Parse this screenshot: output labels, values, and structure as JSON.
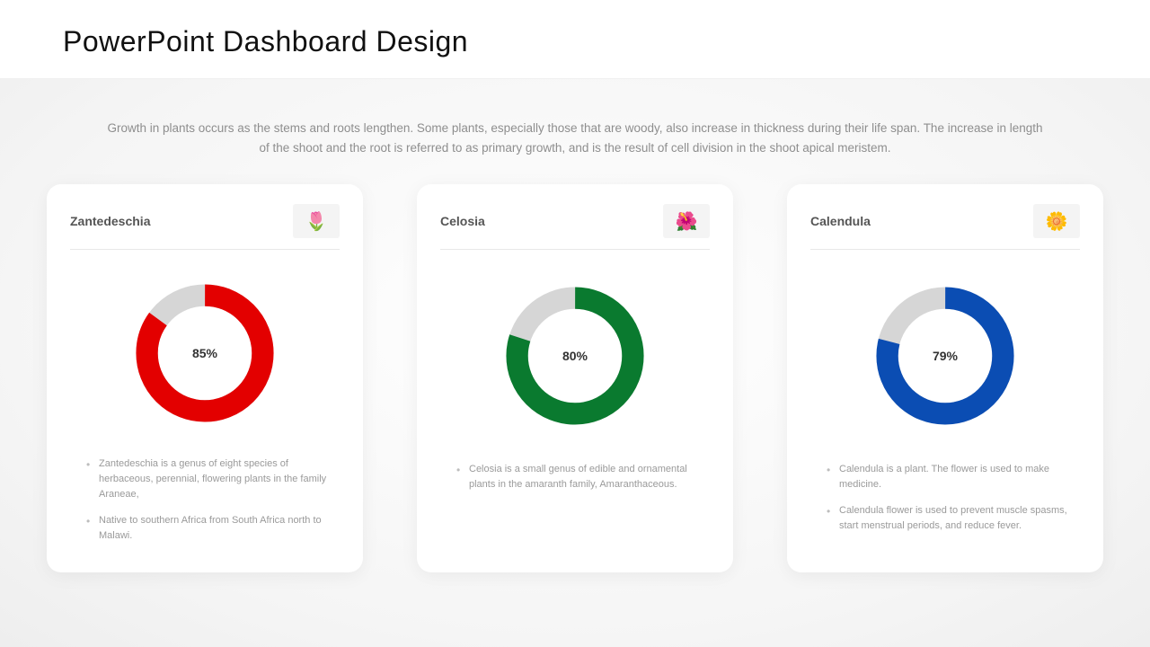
{
  "title": "PowerPoint Dashboard Design",
  "intro": "Growth in plants occurs as the stems and roots lengthen. Some plants, especially those that are woody, also increase in thickness during their life span. The increase in length of the shoot and the root is referred to as primary growth, and is the result of cell division in the shoot apical meristem.",
  "cards": [
    {
      "title": "Zantedeschia",
      "icon": "🌷",
      "percent": 85,
      "percent_label": "85%",
      "color": "#e30000",
      "bg_color": "#d6d6d6",
      "bullets": [
        "Zantedeschia is a genus of eight species of herbaceous, perennial, flowering plants in the family Araneae,",
        "Native to southern Africa from South Africa north to Malawi."
      ]
    },
    {
      "title": "Celosia",
      "icon": "🌺",
      "percent": 80,
      "percent_label": "80%",
      "color": "#0a7a2f",
      "bg_color": "#d6d6d6",
      "bullets": [
        "Celosia is a small genus of edible and ornamental plants in the amaranth family, Amaranthaceous."
      ]
    },
    {
      "title": "Calendula",
      "icon": "🌼",
      "percent": 79,
      "percent_label": "79%",
      "color": "#0b4db3",
      "bg_color": "#d6d6d6",
      "bullets": [
        "Calendula is a plant. The flower is used to make medicine.",
        "Calendula flower is used to prevent muscle spasms, start menstrual periods, and reduce fever."
      ]
    }
  ],
  "chart_data": [
    {
      "type": "pie",
      "title": "Zantedeschia",
      "categories": [
        "value",
        "remaining"
      ],
      "values": [
        85,
        15
      ],
      "colors": [
        "#e30000",
        "#d6d6d6"
      ]
    },
    {
      "type": "pie",
      "title": "Celosia",
      "categories": [
        "value",
        "remaining"
      ],
      "values": [
        80,
        20
      ],
      "colors": [
        "#0a7a2f",
        "#d6d6d6"
      ]
    },
    {
      "type": "pie",
      "title": "Calendula",
      "categories": [
        "value",
        "remaining"
      ],
      "values": [
        79,
        21
      ],
      "colors": [
        "#0b4db3",
        "#d6d6d6"
      ]
    }
  ]
}
